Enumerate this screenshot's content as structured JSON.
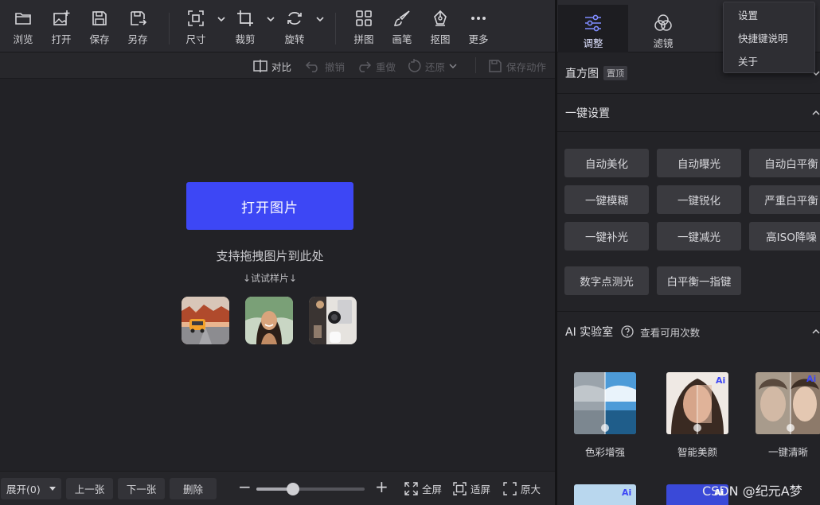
{
  "toolbar": {
    "browse": "浏览",
    "open": "打开",
    "save": "保存",
    "save_as": "另存",
    "resize": "尺寸",
    "crop": "裁剪",
    "rotate": "旋转",
    "collage": "拼图",
    "brush": "画笔",
    "cutout": "抠图",
    "more": "更多"
  },
  "subbar": {
    "compare": "对比",
    "undo": "撤销",
    "redo": "重做",
    "restore": "还原",
    "save_action": "保存动作"
  },
  "canvas": {
    "open_button": "打开图片",
    "drag_hint": "支持拖拽图片到此处",
    "sample_hint": "↓试试样片↓"
  },
  "bottombar": {
    "expand": "展开(0)",
    "prev": "上一张",
    "next": "下一张",
    "delete": "删除",
    "zoom_level": 0.34,
    "fullscreen": "全屏",
    "fit": "适屏",
    "original": "原大"
  },
  "right_tabs": {
    "adjust": "调整",
    "filter": "滤镜"
  },
  "panel": {
    "histogram": "直方图",
    "pin_badge": "置顶",
    "one_click": "一键设置",
    "buttons": [
      "自动美化",
      "自动曝光",
      "自动白平衡",
      "一键模糊",
      "一键锐化",
      "严重白平衡",
      "一键补光",
      "一键减光",
      "高ISO降噪",
      "数字点测光",
      "白平衡一指键"
    ],
    "ai_lab": "AI 实验室",
    "check_uses": "查看可用次数",
    "ai_cards": [
      "色彩增强",
      "智能美颜",
      "一键清晰"
    ]
  },
  "menu": {
    "settings": "设置",
    "shortcuts": "快捷键说明",
    "about": "关于"
  },
  "watermark": "CSDN @纪元A梦",
  "colors": {
    "accent": "#3d47f5",
    "panel_bg": "#232327",
    "toolbar_bg": "#2a2a2f"
  }
}
